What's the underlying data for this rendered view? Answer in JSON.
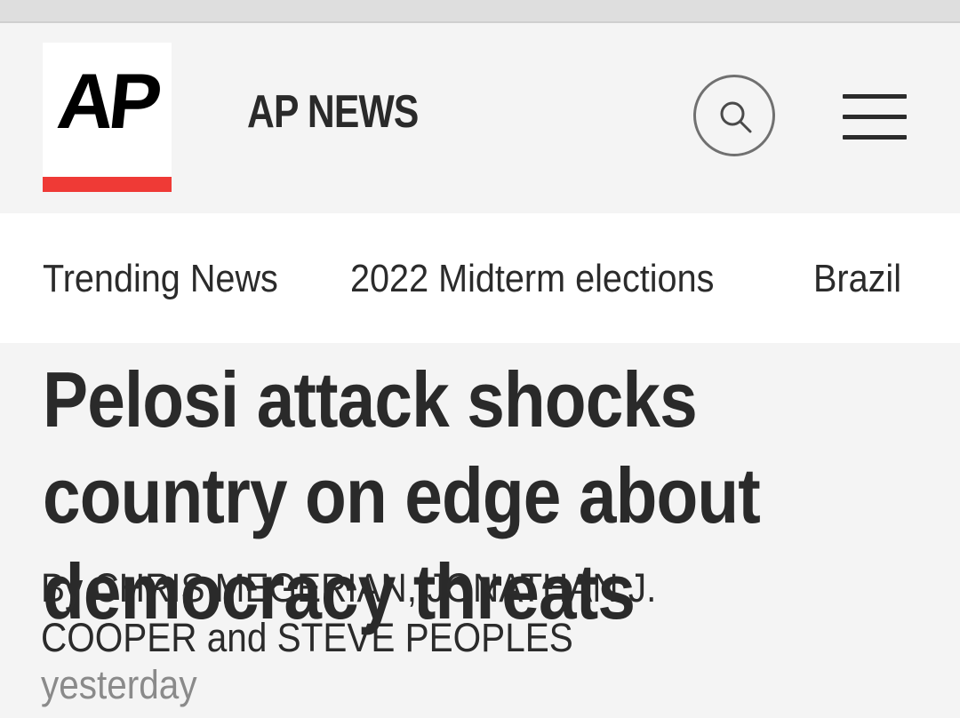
{
  "header": {
    "logo_text": "AP",
    "brand_name": "AP NEWS",
    "search_icon": "search-icon",
    "menu_icon": "hamburger-menu-icon",
    "colors": {
      "logo_bar": "#ef3a36",
      "header_bg": "#f4f4f4",
      "nav_bg": "#ffffff"
    }
  },
  "nav": {
    "items": [
      {
        "label": "Trending News"
      },
      {
        "label": "2022 Midterm elections"
      },
      {
        "label": "Brazil"
      }
    ]
  },
  "article": {
    "headline": "Pelosi attack shocks country on edge about democracy threats",
    "byline": "By CHRIS MEGERIAN, JONATHAN J. COOPER and STEVE PEOPLES",
    "timestamp": "yesterday"
  }
}
